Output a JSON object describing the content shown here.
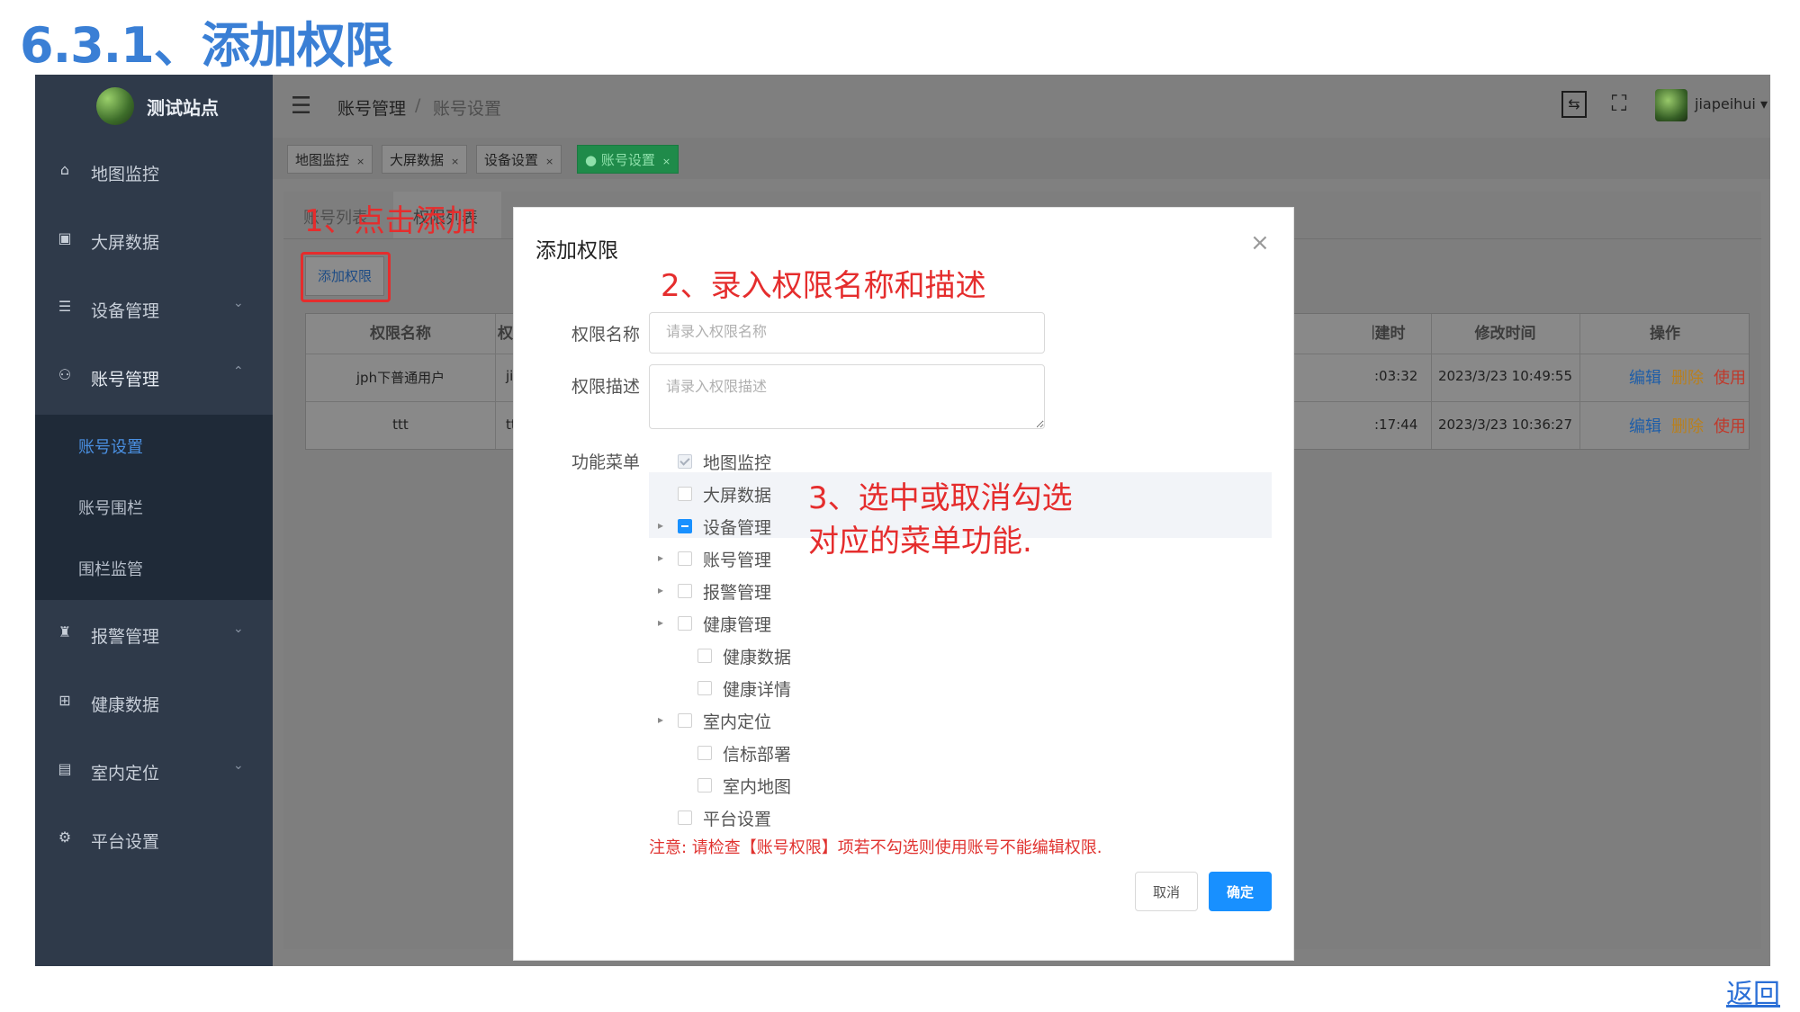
{
  "slide_title": "6.3.1、添加权限",
  "back_link": "返回",
  "sidebar": {
    "site_name": "测试站点",
    "items": [
      {
        "label": "地图监控",
        "icon": "home-icon"
      },
      {
        "label": "大屏数据",
        "icon": "chart-icon"
      },
      {
        "label": "设备管理",
        "icon": "device-icon",
        "chevron": "⌄"
      },
      {
        "label": "账号管理",
        "icon": "org-icon",
        "chevron": "⌃"
      },
      {
        "label": "报警管理",
        "icon": "alarm-icon",
        "chevron": "⌄"
      },
      {
        "label": "健康数据",
        "icon": "health-icon"
      },
      {
        "label": "室内定位",
        "icon": "location-icon",
        "chevron": "⌄"
      },
      {
        "label": "平台设置",
        "icon": "gear-icon"
      }
    ],
    "sub_items": [
      "账号设置",
      "账号围栏",
      "围栏监管"
    ]
  },
  "topbar": {
    "breadcrumb": [
      "账号管理",
      "账号设置"
    ],
    "breadcrumb_sep": "/",
    "username": "jiapeihui ▾"
  },
  "tags": [
    {
      "label": "地图监控",
      "close": "×"
    },
    {
      "label": "大屏数据",
      "close": "×"
    },
    {
      "label": "设备设置",
      "close": "×"
    },
    {
      "label": "● 账号设置",
      "close": "×"
    }
  ],
  "card": {
    "tabs": [
      "账号列表",
      "权限列表"
    ],
    "add_button": "添加权限",
    "table": {
      "headers": [
        "权限名称",
        "权限描述",
        "创建时间",
        "修改时间",
        "操作"
      ],
      "rows": [
        {
          "name": "jph下普通用户",
          "desc": "jia",
          "created": ":03:32",
          "modified": "2023/3/23 10:49:55"
        },
        {
          "name": "ttt",
          "desc": "tt",
          "created": ":17:44",
          "modified": "2023/3/23 10:36:27"
        }
      ],
      "ops": [
        "编辑",
        "删除",
        "使用"
      ],
      "op_colors": {
        "edit": "#1f5ea8",
        "delete": "#b8801f",
        "use": "#c0392b"
      }
    }
  },
  "modal": {
    "title": "添加权限",
    "close": "×",
    "name_label": "权限名称",
    "name_placeholder": "请录入权限名称",
    "desc_label": "权限描述",
    "desc_placeholder": "请录入权限描述",
    "menu_label": "功能菜单",
    "tree": [
      {
        "label": "地图监控",
        "state": "checked-disabled",
        "level": 0,
        "expandable": false
      },
      {
        "label": "大屏数据",
        "state": "unchecked",
        "level": 0,
        "expandable": false
      },
      {
        "label": "设备管理",
        "state": "indeterminate",
        "level": 0,
        "expandable": true
      },
      {
        "label": "账号管理",
        "state": "unchecked",
        "level": 0,
        "expandable": true
      },
      {
        "label": "报警管理",
        "state": "unchecked",
        "level": 0,
        "expandable": true
      },
      {
        "label": "健康管理",
        "state": "unchecked",
        "level": 0,
        "expandable": true
      },
      {
        "label": "健康数据",
        "state": "unchecked",
        "level": 1,
        "expandable": false
      },
      {
        "label": "健康详情",
        "state": "unchecked",
        "level": 1,
        "expandable": false
      },
      {
        "label": "室内定位",
        "state": "unchecked",
        "level": 0,
        "expandable": true
      },
      {
        "label": "信标部署",
        "state": "unchecked",
        "level": 1,
        "expandable": false
      },
      {
        "label": "室内地图",
        "state": "unchecked",
        "level": 1,
        "expandable": false
      },
      {
        "label": "平台设置",
        "state": "unchecked",
        "level": 0,
        "expandable": false
      }
    ],
    "notice": "注意: 请检查【账号权限】项若不勾选则使用账号不能编辑权限.",
    "cancel": "取消",
    "confirm": "确定"
  },
  "annotations": {
    "step1": "1、点击添加",
    "step2": "2、录入权限名称和描述",
    "step3_line1": "3、选中或取消勾选",
    "step3_line2": "对应的菜单功能."
  },
  "colors": {
    "title": "#3a7fd5",
    "annotation": "#e52d2d",
    "primary": "#1890ff",
    "sidebar": "#2f3a4a"
  }
}
